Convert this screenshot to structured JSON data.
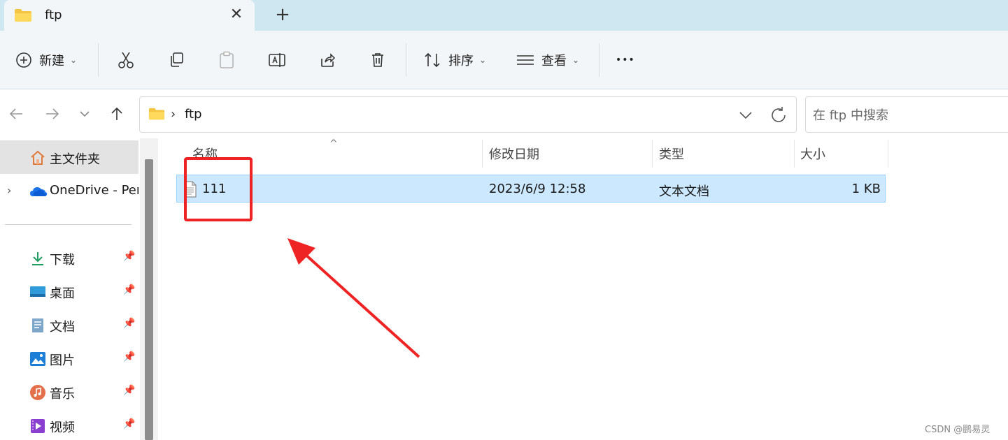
{
  "tab": {
    "title": "ftp",
    "close_glyph": "✕",
    "new_tab_glyph": "+"
  },
  "ribbon": {
    "new_label": "新建",
    "sort_label": "排序",
    "view_label": "查看",
    "more_glyph": "•••"
  },
  "address": {
    "crumb_separator": "›",
    "crumbs": [
      "ftp"
    ]
  },
  "search": {
    "placeholder": "在 ftp 中搜索"
  },
  "sidebar": {
    "items": [
      {
        "label": "主文件夹",
        "icon": "home-icon"
      },
      {
        "label": "OneDrive - Per",
        "icon": "onedrive-icon",
        "expand_glyph": "›"
      },
      {
        "label": "下载",
        "icon": "download-icon",
        "pinned": true
      },
      {
        "label": "桌面",
        "icon": "desktop-icon",
        "pinned": true
      },
      {
        "label": "文档",
        "icon": "documents-icon",
        "pinned": true
      },
      {
        "label": "图片",
        "icon": "pictures-icon",
        "pinned": true
      },
      {
        "label": "音乐",
        "icon": "music-icon",
        "pinned": true
      },
      {
        "label": "视频",
        "icon": "videos-icon",
        "pinned": true
      }
    ]
  },
  "file_list": {
    "columns": [
      "名称",
      "修改日期",
      "类型",
      "大小"
    ],
    "sort_glyph": "^",
    "rows": [
      {
        "name": "111",
        "modified": "2023/6/9 12:58",
        "type": "文本文档",
        "size": "1 KB",
        "selected": true
      }
    ]
  },
  "watermark": "CSDN @鹏易灵",
  "colors": {
    "tabbar": "#cfe7f0",
    "ribbon": "#f3f6f9",
    "selection": "#cce8ff",
    "annotation": "#ee2424"
  }
}
